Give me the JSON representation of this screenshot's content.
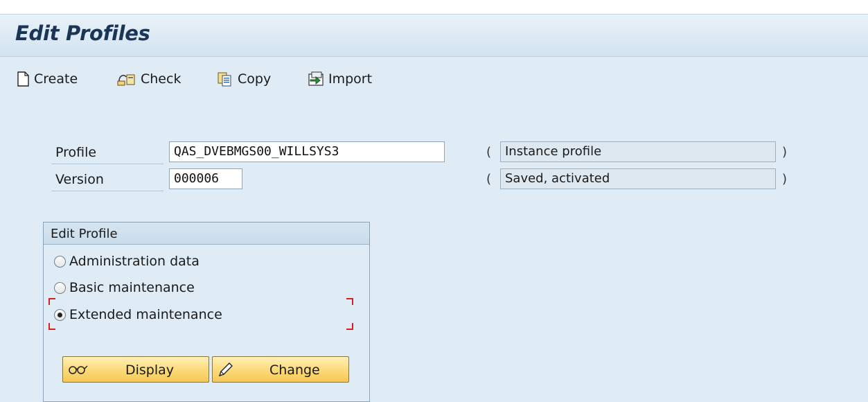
{
  "window": {
    "title": "Edit Profiles"
  },
  "toolbar": {
    "create": "Create",
    "check": "Check",
    "copy": "Copy",
    "import": "Import"
  },
  "form": {
    "profile_label": "Profile",
    "profile_value": "QAS_DVEBMGS00_WILLSYS3",
    "profile_type": "Instance profile",
    "version_label": "Version",
    "version_value": "000006",
    "version_status": "Saved, activated",
    "open_paren": "(",
    "close_paren": ")"
  },
  "edit_profile": {
    "title": "Edit Profile",
    "options": [
      {
        "label": "Administration data",
        "selected": false
      },
      {
        "label": "Basic maintenance",
        "selected": false
      },
      {
        "label": "Extended maintenance",
        "selected": true
      }
    ],
    "display_button": "Display",
    "change_button": "Change"
  },
  "colors": {
    "background": "#dfebf5",
    "title_text": "#1b3556",
    "button_fill": "#fbd977",
    "focus_marker": "#d62020"
  }
}
